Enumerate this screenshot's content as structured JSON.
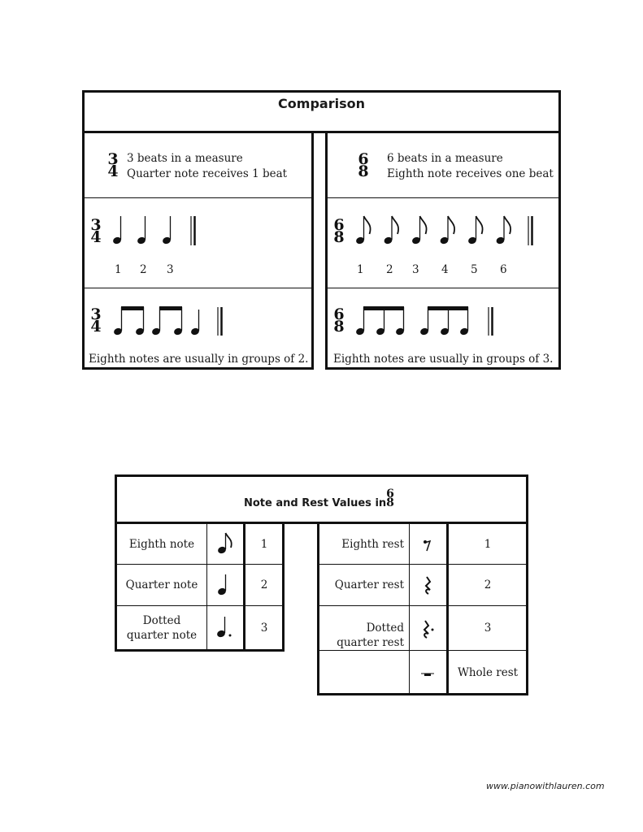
{
  "comparison": {
    "title": "Comparison",
    "left": {
      "time_signature": {
        "top": "3",
        "bottom": "4"
      },
      "description": [
        "3  beats in a measure",
        "Quarter note receives 1 beat"
      ],
      "example1": {
        "notes": [
          "quarter",
          "quarter",
          "quarter"
        ],
        "counts": [
          "1",
          "2",
          "3"
        ]
      },
      "example2": {
        "groups": "two beamed pairs of eighth notes then a quarter note"
      },
      "caption": "Eighth notes are usually in groups of 2."
    },
    "right": {
      "time_signature": {
        "top": "6",
        "bottom": "8"
      },
      "description": [
        "6 beats in a measure",
        "Eighth note receives one beat"
      ],
      "example1": {
        "notes": [
          "eighth",
          "eighth",
          "eighth",
          "eighth",
          "eighth",
          "eighth"
        ],
        "counts": [
          "1",
          "2",
          "3",
          "4",
          "5",
          "6"
        ]
      },
      "example2": {
        "groups": "two beamed groups of three eighth notes"
      },
      "caption": "Eighth notes are usually in groups of 3."
    }
  },
  "values_table": {
    "title": "Note and Rest Values in",
    "time_signature": {
      "top": "6",
      "bottom": "8"
    },
    "notes": [
      {
        "name": "Eighth note",
        "symbol": "eighth-note-icon",
        "value": "1"
      },
      {
        "name": "Quarter note",
        "symbol": "quarter-note-icon",
        "value": "2"
      },
      {
        "name_line1": "Dotted",
        "name_line2": "quarter note",
        "symbol": "dotted-quarter-note-icon",
        "value": "3"
      }
    ],
    "rests": [
      {
        "name": "Eighth rest",
        "symbol": "eighth-rest-icon",
        "value": "1"
      },
      {
        "name": "Quarter rest",
        "symbol": "quarter-rest-icon",
        "value": "2"
      },
      {
        "name_line1": "Dotted",
        "name_line2": "quarter rest",
        "symbol": "dotted-quarter-rest-icon",
        "value": "3"
      },
      {
        "name": "",
        "symbol": "whole-rest-icon",
        "value": "Whole rest"
      }
    ]
  },
  "footer": {
    "url": "www.pianowithlauren.com"
  }
}
